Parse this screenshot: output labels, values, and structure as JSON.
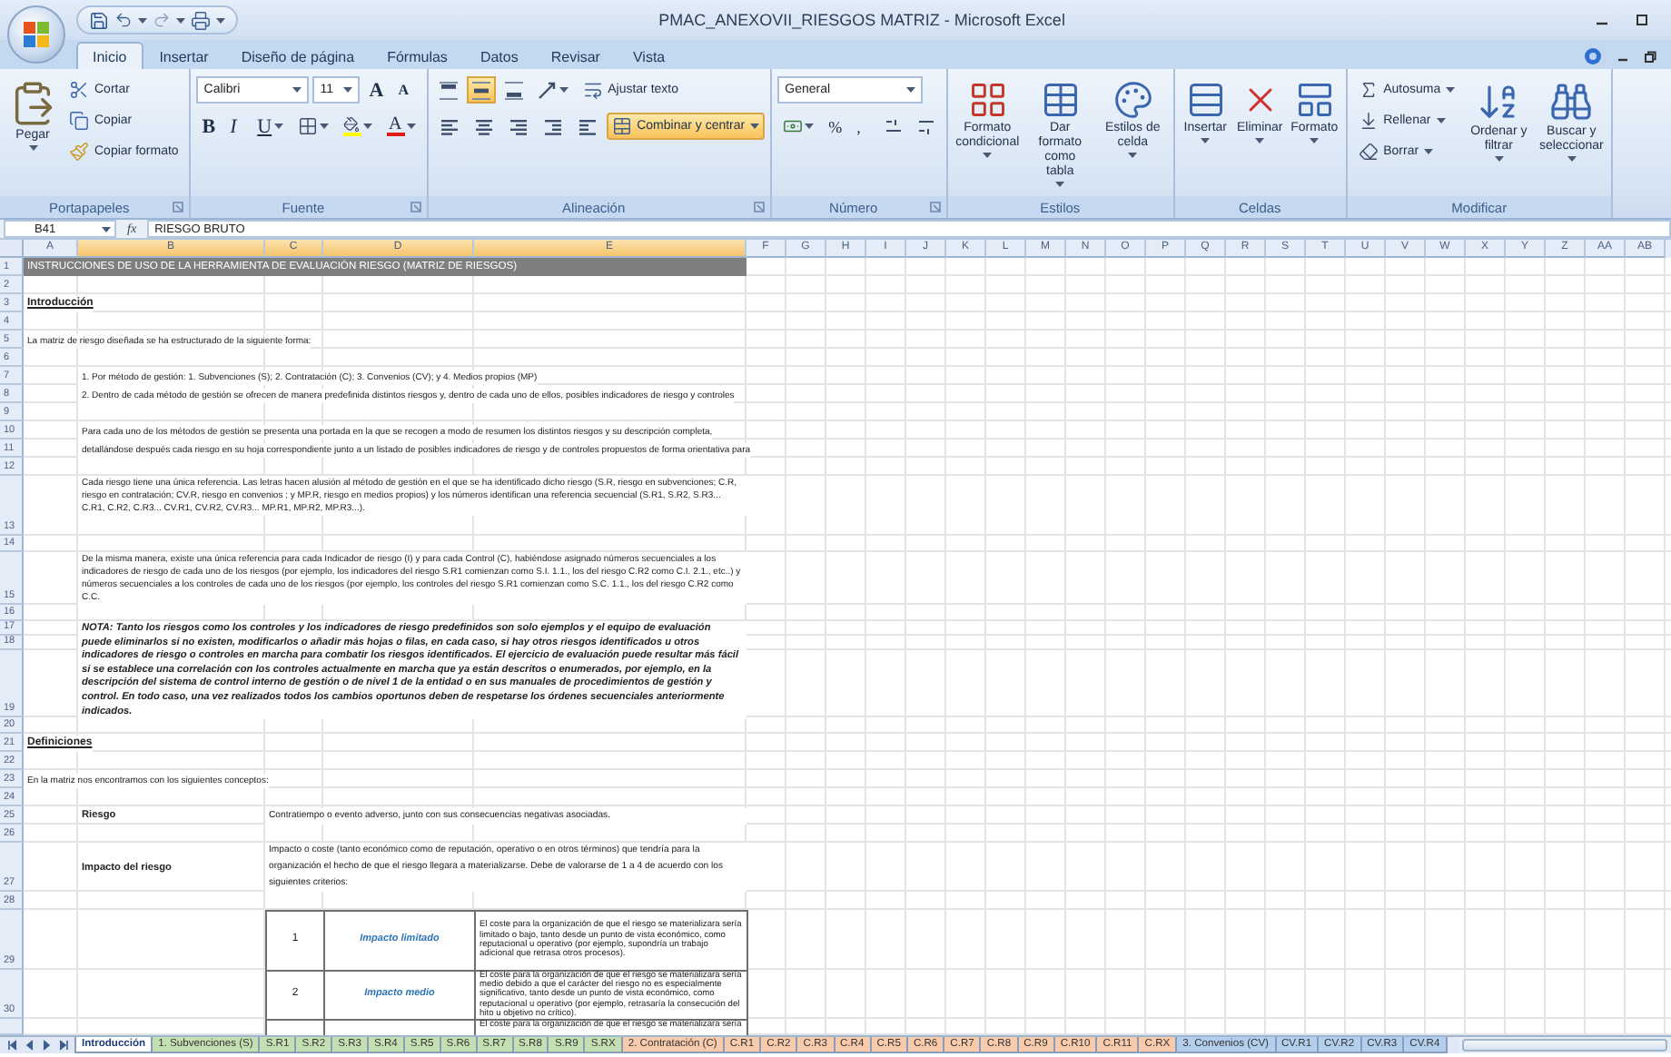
{
  "window": {
    "title": "PMAC_ANEXOVII_RIESGOS MATRIZ - Microsoft Excel"
  },
  "ribbon_tabs": [
    {
      "label": "Inicio",
      "selected": true
    },
    {
      "label": "Insertar",
      "selected": false
    },
    {
      "label": "Diseño de página",
      "selected": false
    },
    {
      "label": "Fórmulas",
      "selected": false
    },
    {
      "label": "Datos",
      "selected": false
    },
    {
      "label": "Revisar",
      "selected": false
    },
    {
      "label": "Vista",
      "selected": false
    }
  ],
  "groups": [
    {
      "kind": "clipboard",
      "label": "Portapapeles",
      "launcher": true,
      "paste": "Pegar",
      "items": [
        "Cortar",
        "Copiar",
        "Copiar formato"
      ]
    },
    {
      "kind": "font",
      "label": "Fuente",
      "launcher": true,
      "font": "Calibri",
      "size": "11",
      "size_buttons": [
        "A",
        "A"
      ],
      "styles": [
        "B",
        "I",
        "U"
      ],
      "color_letter": "A"
    },
    {
      "kind": "alignment",
      "label": "Alineación",
      "launcher": true,
      "vertical": [
        {
          "selected": false
        },
        {
          "selected": true
        },
        {
          "selected": false
        }
      ],
      "wrap": "Ajustar texto",
      "merge": "Combinar y centrar",
      "merge_highlighted": true
    },
    {
      "kind": "number",
      "label": "Número",
      "launcher": true,
      "format": "General",
      "symbols": [
        "%",
        ","
      ]
    },
    {
      "kind": "large",
      "label": "Estilos",
      "launcher": false,
      "buttons": [
        "Formato condicional",
        "Dar formato como tabla",
        "Estilos de celda"
      ]
    },
    {
      "kind": "large",
      "label": "Celdas",
      "launcher": false,
      "buttons": [
        "Insertar",
        "Eliminar",
        "Formato"
      ]
    },
    {
      "kind": "editing",
      "label": "Modificar",
      "launcher": false,
      "small": [
        "Autosuma",
        "Rellenar",
        "Borrar"
      ],
      "large": [
        "Ordenar y filtrar",
        "Buscar y seleccionar"
      ]
    }
  ],
  "formula_bar": {
    "name_box": "B41",
    "function_label": "fx",
    "value": "RIESGO BRUTO"
  },
  "columns": [
    {
      "label": "A",
      "selected": false
    },
    {
      "label": "B",
      "selected": true
    },
    {
      "label": "C",
      "selected": true
    },
    {
      "label": "D",
      "selected": true
    },
    {
      "label": "E",
      "selected": true
    },
    {
      "label": "F",
      "selected": false
    },
    {
      "label": "G",
      "selected": false
    },
    {
      "label": "H",
      "selected": false
    },
    {
      "label": "I",
      "selected": false
    },
    {
      "label": "J",
      "selected": false
    },
    {
      "label": "K",
      "selected": false
    },
    {
      "label": "L",
      "selected": false
    },
    {
      "label": "M",
      "selected": false
    },
    {
      "label": "N",
      "selected": false
    },
    {
      "label": "O",
      "selected": false
    },
    {
      "label": "P",
      "selected": false
    },
    {
      "label": "Q",
      "selected": false
    },
    {
      "label": "R",
      "selected": false
    },
    {
      "label": "S",
      "selected": false
    },
    {
      "label": "T",
      "selected": false
    },
    {
      "label": "U",
      "selected": false
    },
    {
      "label": "V",
      "selected": false
    },
    {
      "label": "W",
      "selected": false
    },
    {
      "label": "X",
      "selected": false
    },
    {
      "label": "Y",
      "selected": false
    },
    {
      "label": "Z",
      "selected": false
    },
    {
      "label": "AA",
      "selected": false
    },
    {
      "label": "AB",
      "selected": false
    }
  ],
  "rows": [
    {
      "number": "1",
      "content": {
        "kind": "banner",
        "text": "INSTRUCCIONES DE USO DE LA HERRAMIENTA DE EVALUACIÓN RIESGO (MATRIZ DE RIESGOS)"
      }
    },
    {
      "number": "2"
    },
    {
      "number": "3",
      "content": {
        "kind": "heading",
        "text": "Introducción"
      }
    },
    {
      "number": "4"
    },
    {
      "number": "5",
      "content": {
        "kind": "text",
        "text": "La matriz de riesgo diseñada se ha estructurado de la siguiente forma:"
      }
    },
    {
      "number": "6"
    },
    {
      "number": "7",
      "content": {
        "kind": "line",
        "text": "1. Por método de gestión: 1. Subvenciones (S); 2. Contratación (C); 3. Convenios (CV); y 4. Medios propios (MP)"
      }
    },
    {
      "number": "8",
      "content": {
        "kind": "line",
        "text": "2. Dentro de cada método de gestión se ofrecen de manera predefinida distintos riesgos y, dentro de cada uno de ellos, posibles indicadores de riesgo y controles"
      }
    },
    {
      "number": "9"
    },
    {
      "number": "10",
      "content": {
        "kind": "line",
        "text": "Para cada uno de los métodos de gestión se presenta una portada en la que se recogen a modo de resumen los distintos riesgos y su descripción completa,"
      }
    },
    {
      "number": "11",
      "content": {
        "kind": "line",
        "text": "detallándose después cada riesgo en su hoja correspondiente junto a un listado de posibles indicadores de riesgo y de controles propuestos de forma orientativa para"
      }
    },
    {
      "number": "12"
    },
    {
      "number": "13",
      "content": {
        "kind": "para",
        "text": "Cada riesgo tiene una única referencia. Las letras hacen alusión al método de gestión en el que se ha identificado dicho riesgo (S.R, riesgo en subvenciones; C.R, riesgo en contratación; CV.R, riesgo en convenios ; y MP.R, riesgo en medios propios) y los números identifican una referencia secuencial (S.R1, S.R2, S.R3... C.R1, C.R2, C.R3... CV.R1, CV.R2, CV.R3... MP.R1, MP.R2, MP.R3...)."
      }
    },
    {
      "number": "14"
    },
    {
      "number": "15",
      "content": {
        "kind": "para",
        "text": "De la misma manera, existe una única referencia para cada Indicador de riesgo (I) y para cada Control (C), habiéndose asignado números secuenciales a los indicadores de riesgo de cada uno de los riesgos (por ejemplo, los indicadores del riesgo S.R1 comienzan como S.I. 1.1., los del riesgo C.R2 como C.I. 2.1., etc..) y números secuenciales a los controles de cada uno de los riesgos (por ejemplo, los controles del riesgo S.R1 comienzan como S.C. 1.1., los del riesgo C.R2 como C.C."
      }
    },
    {
      "number": "16"
    },
    {
      "number": "17",
      "content": {
        "kind": "note",
        "text": "NOTA:  Tanto los riesgos como los controles y los indicadores de riesgo predefinidos son solo ejemplos y el equipo de evaluación puede eliminarlos si no existen, modificarlos o añadir más hojas o filas, en cada caso, si hay otros riesgos identificados u otros indicadores de riesgo o controles en marcha para combatir los riesgos identificados. El ejercicio de evaluación puede resultar más fácil si se establece una correlación con los controles actualmente en marcha que ya están descritos o enumerados, por ejemplo, en la descripción del sistema de control interno de gestión o de nivel 1 de la entidad o en sus manuales de procedimientos de gestión y control. En todo caso, una vez realizados todos los cambios oportunos deben de respetarse los órdenes secuenciales anteriormente indicados."
      }
    },
    {
      "number": "18"
    },
    {
      "number": "19"
    },
    {
      "number": "20"
    },
    {
      "number": "21",
      "content": {
        "kind": "heading",
        "text": "Definiciones"
      }
    },
    {
      "number": "22"
    },
    {
      "number": "23",
      "content": {
        "kind": "text",
        "text": "En la matriz nos encontramos con los siguientes conceptos:"
      }
    },
    {
      "number": "24"
    },
    {
      "number": "25",
      "content": {
        "kind": "term",
        "term": "Riesgo",
        "definition": "Contratiempo o evento adverso, junto con sus consecuencias negativas asociadas."
      }
    },
    {
      "number": "26"
    },
    {
      "number": "27",
      "content": {
        "kind": "term",
        "term": "Impacto del riesgo",
        "definition": "Impacto o coste (tanto económico como de reputación, operativo o en otros términos) que tendría para la organización el hecho de que el riesgo llegara a materializarse. Debe de valorarse de 1 a 4 de acuerdo con los siguientes criterios:"
      }
    },
    {
      "number": "28"
    },
    {
      "number": "29",
      "content": {
        "kind": "criterion",
        "level": "1",
        "name": "Impacto limitado",
        "text": "El coste para la organización de que el riesgo se materializara sería limitado o bajo, tanto desde un punto de vista económico, como reputacional u operativo (por ejemplo, supondría un trabajo adicional que retrasa otros procesos)."
      }
    },
    {
      "number": "30",
      "content": {
        "kind": "criterion",
        "level": "2",
        "name": "Impacto medio",
        "text": "El coste para la organización de que el riesgo se materializara sería medio debido a que el carácter del riesgo no es especialmente significativo, tanto desde un punto de vista económico, como reputacional u operativo (por ejemplo, retrasaría la consecución del hito u objetivo no crítico)."
      }
    },
    {
      "content": {
        "kind": "criterion",
        "text": "El coste para la organización de que el riesgo se materializara sería"
      }
    }
  ],
  "sheet_tabs": [
    {
      "label": "Introducción",
      "selected": true,
      "color": "#ffffff"
    },
    {
      "label": "1. Subvenciones (S)",
      "selected": false,
      "color": "#c4e0b2"
    },
    {
      "label": "S.R1",
      "selected": false,
      "color": "#c4e0b2"
    },
    {
      "label": "S.R2",
      "selected": false,
      "color": "#c4e0b2"
    },
    {
      "label": "S.R3",
      "selected": false,
      "color": "#c4e0b2"
    },
    {
      "label": "S.R4",
      "selected": false,
      "color": "#c4e0b2"
    },
    {
      "label": "S.R5",
      "selected": false,
      "color": "#c4e0b2"
    },
    {
      "label": "S.R6",
      "selected": false,
      "color": "#c4e0b2"
    },
    {
      "label": "S.R7",
      "selected": false,
      "color": "#c4e0b2"
    },
    {
      "label": "S.R8",
      "selected": false,
      "color": "#c4e0b2"
    },
    {
      "label": "S.R9",
      "selected": false,
      "color": "#c4e0b2"
    },
    {
      "label": "S.RX",
      "selected": false,
      "color": "#c4e0b2"
    },
    {
      "label": "2. Contratación (C)",
      "selected": false,
      "color": "#f8cbad"
    },
    {
      "label": "C.R1",
      "selected": false,
      "color": "#f8cbad"
    },
    {
      "label": "C.R2",
      "selected": false,
      "color": "#f8cbad"
    },
    {
      "label": "C.R3",
      "selected": false,
      "color": "#f8cbad"
    },
    {
      "label": "C.R4",
      "selected": false,
      "color": "#f8cbad"
    },
    {
      "label": "C.R5",
      "selected": false,
      "color": "#f8cbad"
    },
    {
      "label": "C.R6",
      "selected": false,
      "color": "#f8cbad"
    },
    {
      "label": "C.R7",
      "selected": false,
      "color": "#f8cbad"
    },
    {
      "label": "C.R8",
      "selected": false,
      "color": "#f8cbad"
    },
    {
      "label": "C.R9",
      "selected": false,
      "color": "#f8cbad"
    },
    {
      "label": "C.R10",
      "selected": false,
      "color": "#f8cbad"
    },
    {
      "label": "C.R11",
      "selected": false,
      "color": "#f8cbad"
    },
    {
      "label": "C.RX",
      "selected": false,
      "color": "#f8cbad"
    },
    {
      "label": "3. Convenios (CV)",
      "selected": false,
      "color": "#b4cfee"
    },
    {
      "label": "CV.R1",
      "selected": false,
      "color": "#b4cfee"
    },
    {
      "label": "CV.R2",
      "selected": false,
      "color": "#b4cfee"
    },
    {
      "label": "CV.R3",
      "selected": false,
      "color": "#b4cfee"
    },
    {
      "label": "CV.R4",
      "selected": false,
      "color": "#b4cfee"
    }
  ]
}
